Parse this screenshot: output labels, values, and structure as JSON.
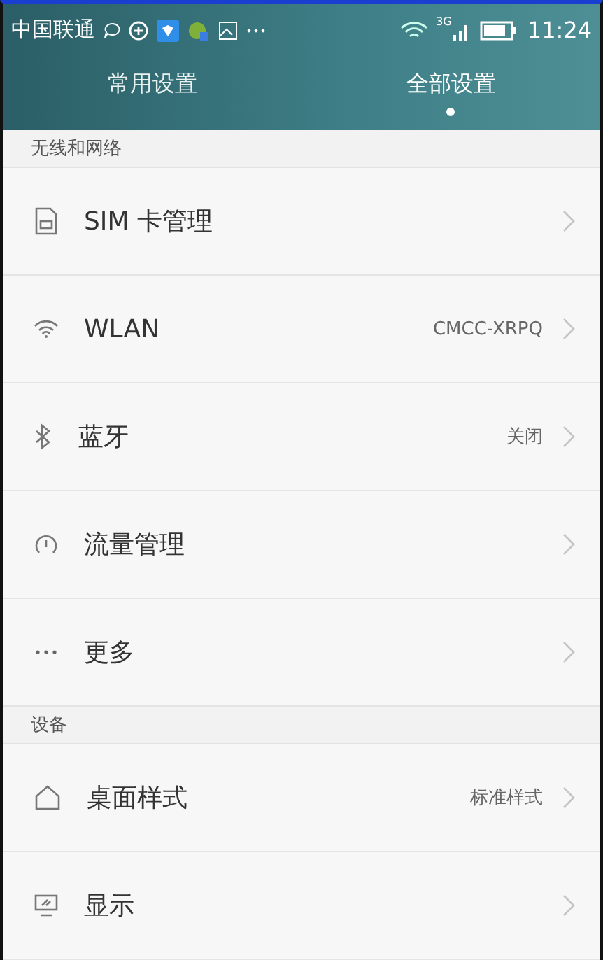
{
  "status_bar": {
    "carrier": "中国联通",
    "time": "11:24",
    "network_label": "3G"
  },
  "tabs": [
    {
      "label": "常用设置",
      "selected": false
    },
    {
      "label": "全部设置",
      "selected": true
    }
  ],
  "sections": [
    {
      "title": "无线和网络",
      "items": [
        {
          "kind": "sim",
          "label": "SIM 卡管理"
        },
        {
          "kind": "wifi",
          "label": "WLAN",
          "value": "CMCC-XRPQ"
        },
        {
          "kind": "bluetooth",
          "label": "蓝牙",
          "value": "关闭"
        },
        {
          "kind": "data",
          "label": "流量管理"
        },
        {
          "kind": "more",
          "label": "更多"
        }
      ]
    },
    {
      "title": "设备",
      "items": [
        {
          "kind": "home",
          "label": "桌面样式",
          "value": "标准样式"
        },
        {
          "kind": "display",
          "label": "显示"
        }
      ]
    }
  ]
}
